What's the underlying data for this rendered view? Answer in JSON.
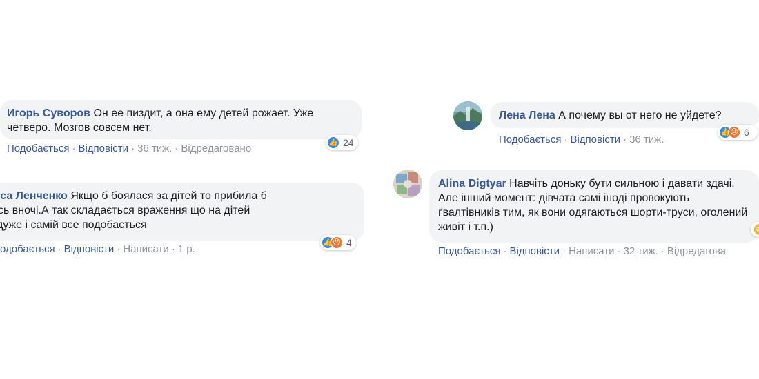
{
  "actions": {
    "like": "Подобається",
    "reply": "Відповісти",
    "write": "Написати",
    "edited": "Відредаговано",
    "edited_cut": "Відредагова"
  },
  "comments": [
    {
      "author": "Игорь Суворов",
      "text": "Он ее пиздит, а она ему детей рожает. Уже четверо. Мозгов совсем нет.",
      "time": "36 тиж.",
      "reaction_count": "24"
    },
    {
      "author": "ріса Ленченко",
      "line1": "Якщо б боялася за дітей то прибила б",
      "line2": "мсь вночі.А так складається враження що на дітей",
      "line3": "йдуже і самій все подобається",
      "like_cut": "одобається",
      "time": "1 р.",
      "reaction_count": "4"
    },
    {
      "author": "Лена Лена",
      "text": "А почему вы от него не уйдете?",
      "time": "36 тиж.",
      "reaction_count": "6"
    },
    {
      "author": "Alina Digtyar",
      "text": "Навчіть доньку бути сильною і давати здачі. Але інший момент: дівчата самі іноді провокують ґвалтівників тим, як вони одягаються шорти-труси, оголений живіт і т.п.)",
      "time": "32 тиж."
    }
  ],
  "icons": {
    "like": "thumbs-up-icon",
    "angry": "angry-face-icon"
  },
  "colors": {
    "author": "#385898",
    "bubble": "#f2f3f5",
    "meta": "#90949c",
    "like": "#2d88ff",
    "angry": "#f0772d"
  }
}
